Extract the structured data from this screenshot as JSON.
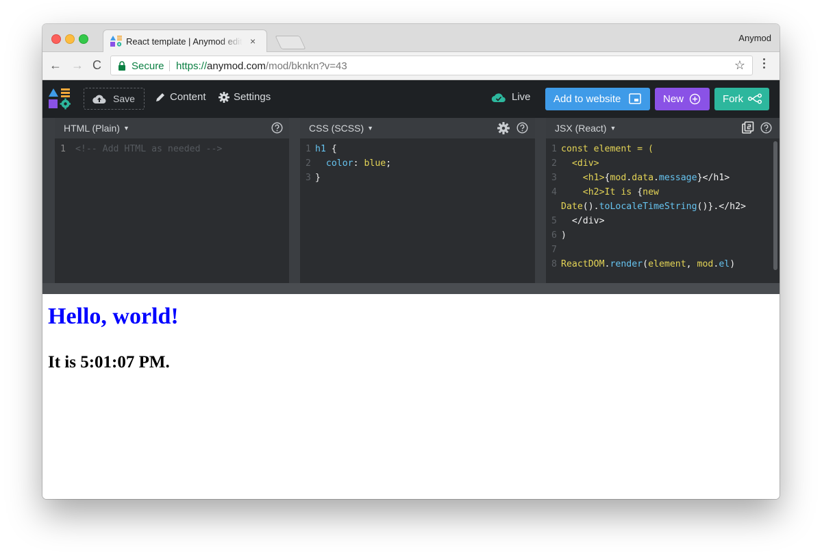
{
  "browser": {
    "tab": {
      "title": "React template | Anymod editor",
      "close_glyph": "×"
    },
    "profile_name": "Anymod",
    "nav": {
      "back": "←",
      "forward": "→",
      "reload": "C"
    },
    "address": {
      "secure_label": "Secure",
      "url_scheme": "https://",
      "url_host": "anymod.com",
      "url_path": "/mod/bknkn?v=43"
    },
    "star_glyph": "☆"
  },
  "app": {
    "save_label": "Save",
    "content_label": "Content",
    "settings_label": "Settings",
    "live_label": "Live",
    "add_to_website_label": "Add to website",
    "new_label": "New",
    "fork_label": "Fork",
    "colors": {
      "header_bg": "#1e2124",
      "add": "#3f9be8",
      "new": "#8a52e6",
      "fork": "#2db79d",
      "live": "#2db79d"
    }
  },
  "panes": {
    "html": {
      "title": "HTML (Plain)",
      "lines": [
        {
          "n": "1",
          "text": "<!-- Add HTML as needed -->"
        }
      ]
    },
    "css": {
      "title": "CSS (SCSS)",
      "line1": {
        "n": "1",
        "sel": "h1",
        "rest": " {"
      },
      "line2": {
        "n": "2",
        "prop": "color",
        "colon": ": ",
        "val": "blue",
        "semi": ";"
      },
      "line3": {
        "n": "3",
        "text": "}"
      }
    },
    "jsx": {
      "title": "JSX (React)",
      "l1": {
        "n": "1",
        "kw": "const element = ("
      },
      "l2": {
        "n": "2",
        "tag": "<div>"
      },
      "l3": {
        "n": "3",
        "open": "<h1>",
        "brace1": "{",
        "a": "mod",
        "dot1": ".",
        "b": "data",
        "dot2": ".",
        "c": "message",
        "brace2": "}",
        "close": "</h1>"
      },
      "l4": {
        "n": "4",
        "open": "<h2>",
        "text": "It is ",
        "brace": "{",
        "kw": "new"
      },
      "l4b": {
        "cls": "Date",
        "p1": "().",
        "m": "toLocaleTimeString",
        "p2": "()}.",
        "close": "</h2>"
      },
      "l5": {
        "n": "5",
        "tag": "</div>"
      },
      "l6": {
        "n": "6",
        "text": ")"
      },
      "l7": {
        "n": "7",
        "text": ""
      },
      "l8": {
        "n": "8",
        "obj": "ReactDOM",
        "dot": ".",
        "m": "render",
        "open": "(",
        "arg1": "element",
        "comma": ", ",
        "arg2a": "mod",
        "dot2": ".",
        "arg2b": "el",
        "close": ")"
      }
    }
  },
  "preview": {
    "heading": "Hello, world!",
    "subheading": "It is 5:01:07 PM."
  }
}
